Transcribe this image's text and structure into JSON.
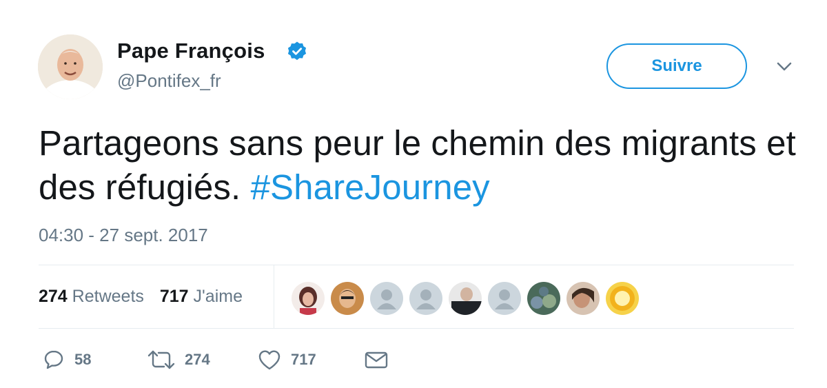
{
  "author": {
    "display_name": "Pape François",
    "handle": "@Pontifex_fr",
    "avatar_icon": "profile-photo",
    "verified_icon": "verified-badge-icon"
  },
  "follow_button": {
    "label": "Suivre"
  },
  "menu_icon": "chevron-down-icon",
  "tweet": {
    "text_before": "Partageons sans peur le chemin des migrants et des réfugiés. ",
    "hashtag": "#ShareJourney",
    "timestamp": "04:30 - 27 sept. 2017"
  },
  "stats": {
    "retweets_count": "274",
    "retweets_label": "Retweets",
    "likes_count": "717",
    "likes_label": "J'aime"
  },
  "likers": [
    {
      "name": "liker-avatar-1",
      "kind": "photo"
    },
    {
      "name": "liker-avatar-2",
      "kind": "photo"
    },
    {
      "name": "liker-avatar-3",
      "kind": "default"
    },
    {
      "name": "liker-avatar-4",
      "kind": "default"
    },
    {
      "name": "liker-avatar-5",
      "kind": "photo"
    },
    {
      "name": "liker-avatar-6",
      "kind": "default"
    },
    {
      "name": "liker-avatar-7",
      "kind": "photo"
    },
    {
      "name": "liker-avatar-8",
      "kind": "photo"
    },
    {
      "name": "liker-avatar-9",
      "kind": "photo"
    }
  ],
  "actions": {
    "reply": {
      "icon": "reply-icon",
      "count": "58"
    },
    "retweet": {
      "icon": "retweet-icon",
      "count": "274"
    },
    "like": {
      "icon": "heart-icon",
      "count": "717"
    },
    "message": {
      "icon": "envelope-icon"
    }
  },
  "colors": {
    "accent": "#1b95e0",
    "text": "#14171a",
    "muted": "#657786",
    "divider": "#e6ecf0"
  }
}
